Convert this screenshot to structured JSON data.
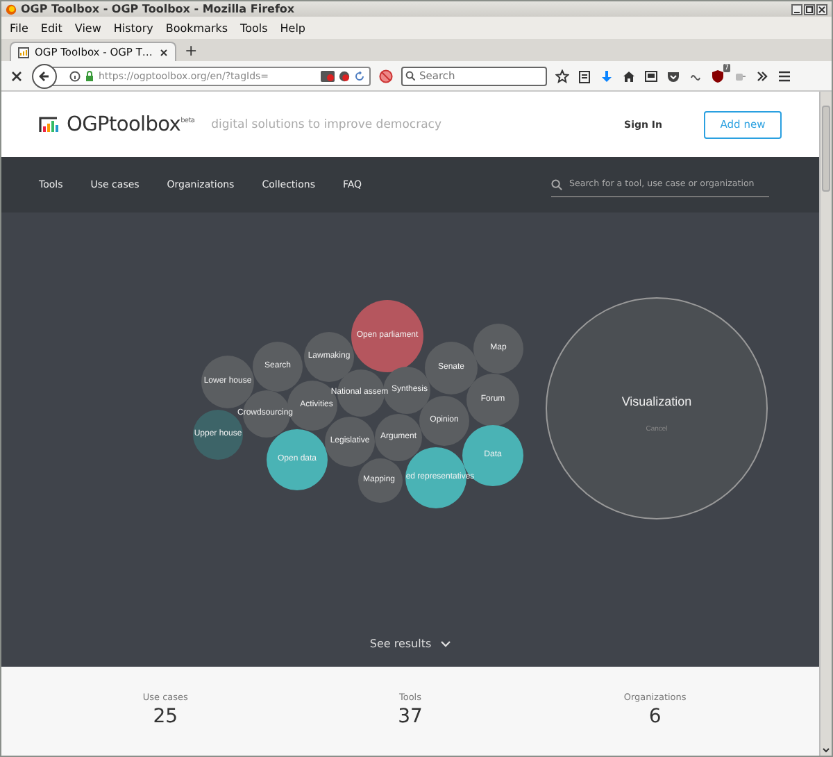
{
  "browser": {
    "title": "OGP Toolbox - OGP Toolbox - Mozilla Firefox",
    "menu": [
      "File",
      "Edit",
      "View",
      "History",
      "Bookmarks",
      "Tools",
      "Help"
    ],
    "tabs": [
      {
        "label": "OGP Toolbox - OGP T…",
        "selected": true
      }
    ],
    "new_tab": "+",
    "url": "https://ogptoolbox.org/en/?tagIds=",
    "search": {
      "placeholder": "Search"
    },
    "addon_badge": "7"
  },
  "header": {
    "logo": "OGPtoolbox",
    "logo_sup": "beta",
    "tagline": "digital solutions to improve democracy",
    "sign_in": "Sign In",
    "add_new": "Add new"
  },
  "nav": {
    "items": [
      "Tools",
      "Use cases",
      "Organizations",
      "Collections",
      "FAQ"
    ],
    "search": {
      "placeholder": "Search for a tool, use case or organization"
    }
  },
  "bubbles": [
    {
      "label": "Lower house",
      "color": "#5b5e61"
    },
    {
      "label": "Search",
      "color": "#5b5e61"
    },
    {
      "label": "Lawmaking",
      "color": "#5b5e61"
    },
    {
      "label": "Open parliament",
      "color": "#b5565e"
    },
    {
      "label": "Map",
      "color": "#5b5e61"
    },
    {
      "label": "Senate",
      "color": "#5b5e61"
    },
    {
      "label": "National assem",
      "color": "#5b5e61"
    },
    {
      "label": "Synthesis",
      "color": "#5b5e61"
    },
    {
      "label": "Crowdsourcing",
      "color": "#5b5e61"
    },
    {
      "label": "Activities",
      "color": "#5b5e61"
    },
    {
      "label": "Forum",
      "color": "#5b5e61"
    },
    {
      "label": "Upper house",
      "color": "#3d6468"
    },
    {
      "label": "Opinion",
      "color": "#5b5e61"
    },
    {
      "label": "Legislative",
      "color": "#5b5e61"
    },
    {
      "label": "Argument",
      "color": "#5b5e61"
    },
    {
      "label": "Open data",
      "color": "#4ab3b5"
    },
    {
      "label": "Data",
      "color": "#4ab3b5"
    },
    {
      "label": "Mapping",
      "color": "#5b5e61"
    },
    {
      "label": "ed representatives",
      "color": "#4ab3b5"
    }
  ],
  "selected_tag": {
    "label": "Visualization",
    "cancel": "Cancel"
  },
  "see_results": "See results",
  "stats": [
    {
      "label": "Use cases",
      "value": "25"
    },
    {
      "label": "Tools",
      "value": "37"
    },
    {
      "label": "Organizations",
      "value": "6"
    }
  ]
}
